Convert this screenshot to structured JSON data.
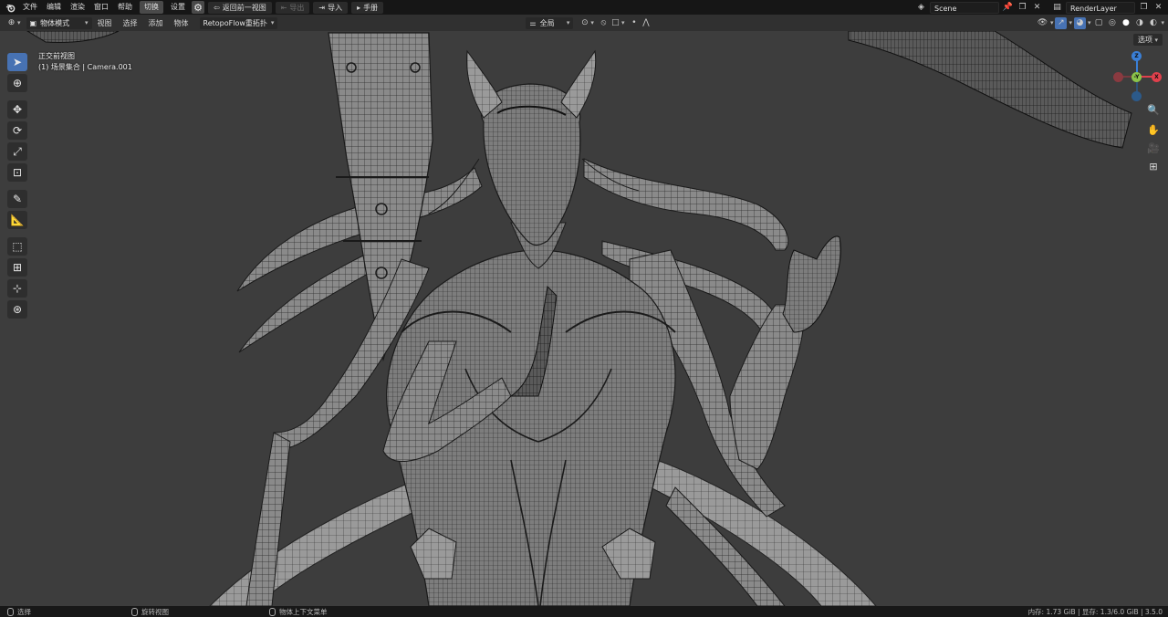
{
  "topbar": {
    "menus": [
      "文件",
      "编辑",
      "渲染",
      "窗口",
      "帮助"
    ],
    "active_workspace": "切换",
    "settings_label": "设置",
    "back_label": "返回前一视图",
    "export_label": "导出",
    "import_label": "导入",
    "manual_label": "手册",
    "scene": "Scene",
    "render_layer": "RenderLayer"
  },
  "viewport_header": {
    "mode": "物体模式",
    "menus": [
      "视图",
      "选择",
      "添加",
      "物体"
    ],
    "retopo": "RetopoFlow重拓扑",
    "transform_orientation": "全局",
    "options_label": "选项"
  },
  "viewport": {
    "view_name": "正交前视图",
    "collection_camera": "(1) 场景集合 | Camera.001",
    "gizmo": {
      "z": "Z",
      "x": "X",
      "y": "-Y"
    }
  },
  "statusbar": {
    "select": "选择",
    "rotate": "旋转视图",
    "context_menu": "物体上下文菜单",
    "stats": "内存: 1.73 GiB | 显存: 1.3/6.0 GiB | 3.5.0"
  },
  "colors": {
    "accent": "#4772b3",
    "background": "#3d3d3d",
    "axis_x": "#e0404c",
    "axis_y": "#8bc34a",
    "axis_z": "#3a7fd6"
  }
}
